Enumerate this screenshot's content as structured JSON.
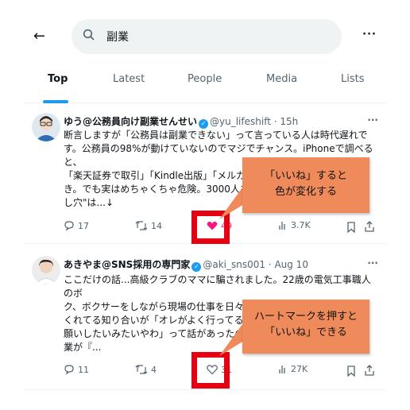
{
  "search": {
    "query": "副業"
  },
  "tabs": [
    {
      "label": "Top",
      "active": true
    },
    {
      "label": "Latest",
      "active": false
    },
    {
      "label": "People",
      "active": false
    },
    {
      "label": "Media",
      "active": false
    },
    {
      "label": "Lists",
      "active": false
    }
  ],
  "tweets": [
    {
      "name": "ゆう@公務員向け副業せんせい",
      "handle": "@yu_lifeshift · 15h",
      "lines": [
        "断言しますが「公務員は副業できない」って言っている人は時代遅れで",
        "す。公務員の98%が動けていないのでマジでチャンス。iPhoneで調べると、",
        "「楽天証券で取引」「Kindle出版」「メルカ",
        "き。でも実はめちゃくちゃ危険。3000人を",
        "し穴\"は...↓"
      ],
      "replies": "17",
      "retweets": "14",
      "likes": "49",
      "views": "3.7K"
    },
    {
      "name": "あきやま@SNS採用の専門家",
      "handle": "@aki_sns001 · Aug 10",
      "lines": [
        "ここだけの話...高級クラブのママに騙されました。22歳の電気工事職人のボ",
        "ク、ボクサーをしながら現場の仕事を日々やって",
        "くれてる知り合いが「オレがよく行ってる夜",
        "願いしたいみたいやわ」って話があったので",
        "業が『..."
      ],
      "replies": "11",
      "retweets": "4",
      "likes": "31",
      "views": "27K"
    }
  ],
  "callouts": [
    {
      "line1": "「いいね」すると",
      "line2": "色が変化する"
    },
    {
      "line1": "ハートマークを押すと",
      "line2": "「いいね」できる"
    }
  ],
  "colors": {
    "accent": "#1d9bf0",
    "like": "#f91880",
    "highlight": "#e60012",
    "callout": "#ef8a5a"
  }
}
